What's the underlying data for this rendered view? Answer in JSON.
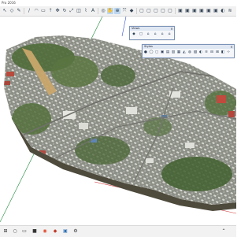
{
  "window": {
    "title": "Pro 2016"
  },
  "toolbar": {
    "icons": [
      "select-icon",
      "eraser-icon",
      "paint-icon",
      "line-icon",
      "arc-icon",
      "rect-icon",
      "pushpull-icon",
      "move-icon",
      "rotate-icon",
      "scale-icon",
      "offset-icon",
      "tape-icon",
      "text-icon",
      "orbit-icon",
      "pan-icon",
      "zoom-icon",
      "zoom-extents-icon",
      "iso-view-icon",
      "top-view-icon",
      "front-view-icon",
      "right-view-icon",
      "back-view-icon",
      "left-view-icon",
      "xray-icon",
      "wireframe-icon",
      "hidden-line-icon",
      "shaded-icon",
      "textured-icon",
      "monochrome-icon"
    ]
  },
  "panels": {
    "views": {
      "title": "Views",
      "icons": [
        "iso-icon",
        "top-icon",
        "front-icon",
        "right-icon",
        "back-icon",
        "left-icon"
      ]
    },
    "styles": {
      "title": "Styles",
      "icons": [
        "xray-icon",
        "back-edges-icon",
        "wireframe-icon",
        "hidden-line-icon",
        "shaded-icon",
        "shaded-textures-icon",
        "monochrome-icon",
        "sandbox-icon",
        "geo-icon",
        "photo-icon",
        "shadow-icon",
        "fog-icon",
        "section-icon",
        "grid-icon",
        "layer-icon",
        "axis-icon"
      ]
    }
  },
  "viewport": {
    "content": "3d-terrain-model-with-aerial-imagery"
  },
  "taskbar": {
    "icons": [
      "windows-start-icon",
      "search-icon",
      "taskview-icon",
      "explorer-icon",
      "chrome-icon",
      "sketchup-icon",
      "photos-icon",
      "settings-icon",
      "tray-icon"
    ]
  }
}
